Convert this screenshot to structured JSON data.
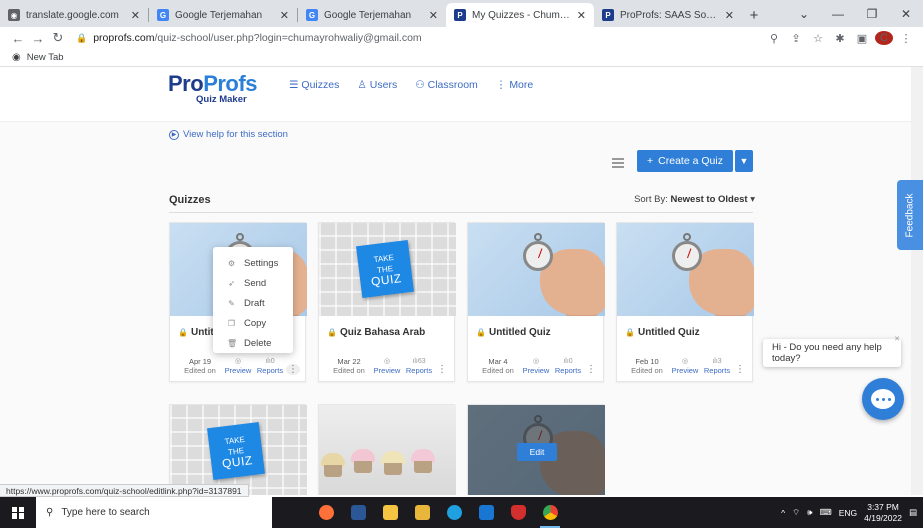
{
  "browser": {
    "tabs": [
      {
        "title": "translate.google.com",
        "color": "#5f6368",
        "glyph": "◉"
      },
      {
        "title": "Google Terjemahan",
        "color": "#4285f4",
        "glyph": "G"
      },
      {
        "title": "Google Terjemahan",
        "color": "#4285f4",
        "glyph": "G"
      },
      {
        "title": "My Quizzes - Chumayrohwali",
        "color": "#1e3c8c",
        "glyph": "P"
      },
      {
        "title": "ProProfs: SAAS Software for",
        "color": "#1e3c8c",
        "glyph": "P"
      }
    ],
    "url_host": "proprofs.com",
    "url_path": "/quiz-school/user.php?login=chumayrohwaliy@gmail.com",
    "bookmark": "New Tab",
    "profile_initial": "C",
    "status_url": "https://www.proprofs.com/quiz-school/editlink.php?id=3137891"
  },
  "logo": {
    "part1": "Pro",
    "part2": "Profs",
    "sub": "Quiz Maker"
  },
  "nav": {
    "quizzes": "Quizzes",
    "users": "Users",
    "classroom": "Classroom",
    "more": "More"
  },
  "help_link": "View help for this section",
  "create_button": "Create a Quiz",
  "section_title": "Quizzes",
  "sort": {
    "label": "Sort By:",
    "value": "Newest to Oldest"
  },
  "cards": [
    {
      "title": "Untitled Quiz",
      "date": "Apr 19",
      "edited": "Edited on",
      "preview": "Preview",
      "reports": "Reports",
      "preview_stat": "◎",
      "reports_stat": "0"
    },
    {
      "title": "Quiz Bahasa Arab",
      "date": "Mar 22",
      "edited": "Edited on",
      "preview": "Preview",
      "reports": "Reports",
      "preview_stat": "◎",
      "reports_stat": "63"
    },
    {
      "title": "Untitled Quiz",
      "date": "Mar 4",
      "edited": "Edited on",
      "preview": "Preview",
      "reports": "Reports",
      "preview_stat": "◎",
      "reports_stat": "0"
    },
    {
      "title": "Untitled Quiz",
      "date": "Feb 10",
      "edited": "Edited on",
      "preview": "Preview",
      "reports": "Reports",
      "preview_stat": "◎",
      "reports_stat": "3"
    }
  ],
  "quiz_sign": {
    "line1": "TAKE",
    "line2": "THE",
    "line3": "QUIZ"
  },
  "menu": {
    "settings": "Settings",
    "send": "Send",
    "draft": "Draft",
    "copy": "Copy",
    "delete": "Delete"
  },
  "edit_label": "Edit",
  "feedback": "Feedback",
  "chat_message": "Hi - Do you need any help today?",
  "taskbar": {
    "search_placeholder": "Type here to search",
    "time": "3:37 PM",
    "date": "4/19/2022",
    "lang": "ENG"
  }
}
